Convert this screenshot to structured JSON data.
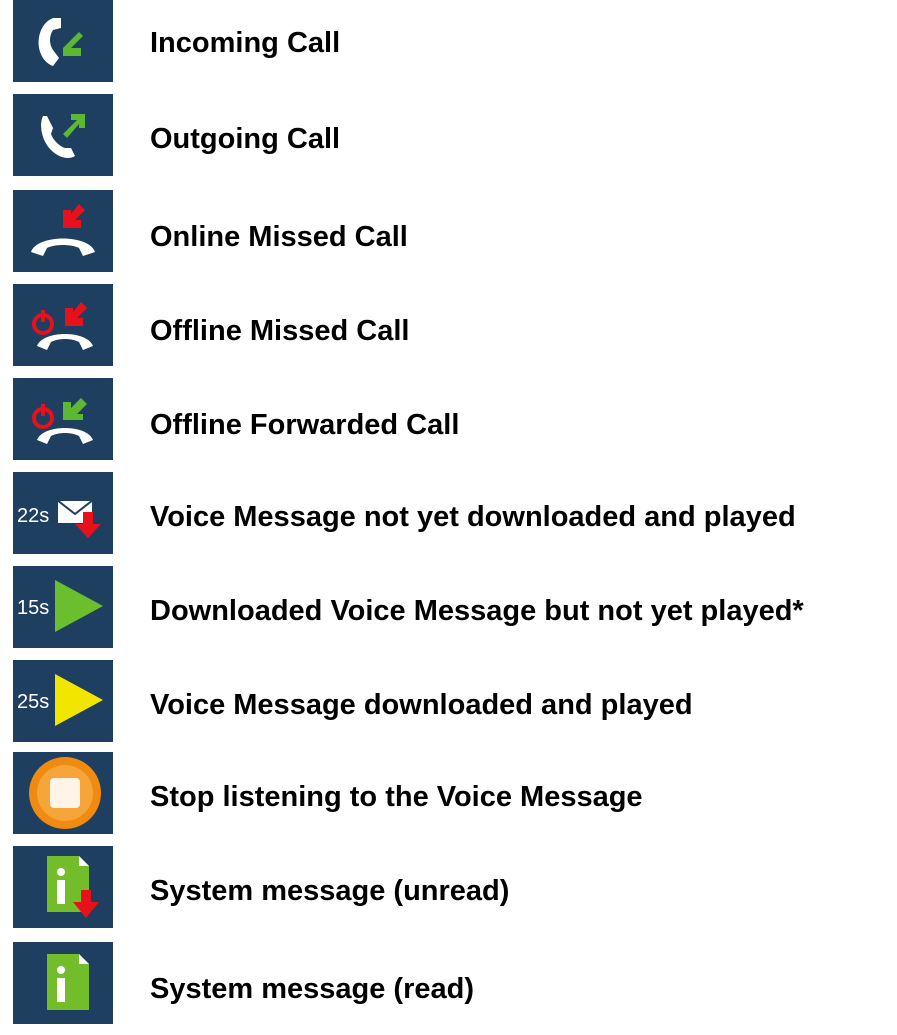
{
  "legend": {
    "items": [
      {
        "icon": "incoming-call-icon",
        "label": "Incoming Call"
      },
      {
        "icon": "outgoing-call-icon",
        "label": "Outgoing Call"
      },
      {
        "icon": "online-missed-call-icon",
        "label": "Online Missed Call"
      },
      {
        "icon": "offline-missed-call-icon",
        "label": "Offline Missed Call"
      },
      {
        "icon": "offline-forwarded-call-icon",
        "label": "Offline Forwarded Call"
      },
      {
        "icon": "voice-message-not-downloaded-icon",
        "icon_text": "22s",
        "label": "Voice Message not yet downloaded and played"
      },
      {
        "icon": "voice-message-downloaded-unplayed-icon",
        "icon_text": "15s",
        "label": "Downloaded Voice Message but not yet played*"
      },
      {
        "icon": "voice-message-played-icon",
        "icon_text": "25s",
        "label": "Voice Message downloaded and played"
      },
      {
        "icon": "stop-voice-message-icon",
        "label": "Stop listening to the Voice Message"
      },
      {
        "icon": "system-message-unread-icon",
        "label": "System message (unread)"
      },
      {
        "icon": "system-message-read-icon",
        "label": "System message (read)"
      }
    ]
  },
  "colors": {
    "tile_background": "#1f3f60",
    "green_arrow": "#5cb832",
    "red_arrow": "#e8101a",
    "play_green": "#6cbf2c",
    "play_yellow": "#f2e600",
    "stop_orange": "#f08a10",
    "doc_green": "#74bd2a"
  }
}
